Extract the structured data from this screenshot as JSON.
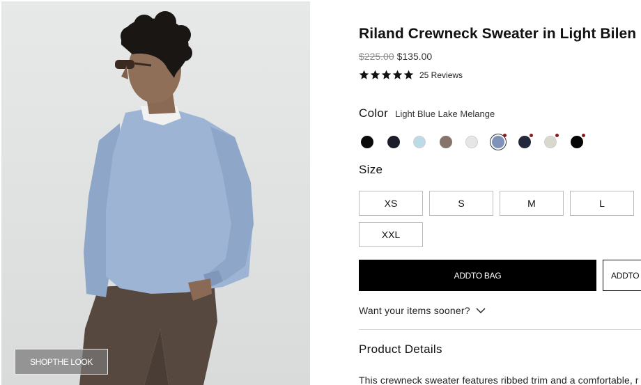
{
  "product": {
    "title": "Riland Crewneck Sweater in Light Bilen",
    "original_price": "$225.00",
    "sale_price": "$135.00",
    "rating": 5,
    "reviews_label": "25 Reviews"
  },
  "image": {
    "shop_the_look_label": "SHOPTHE LOOK"
  },
  "color": {
    "label": "Color",
    "selected_name": "Light Blue Lake Melange",
    "swatches": [
      {
        "color": "#0a0a0a",
        "selected": false,
        "flag": false
      },
      {
        "color": "#1b1e28",
        "selected": false,
        "flag": false
      },
      {
        "color": "#bcdbe6",
        "selected": false,
        "flag": false
      },
      {
        "color": "#857469",
        "selected": false,
        "flag": false
      },
      {
        "color": "#e6e6e6",
        "selected": false,
        "flag": false
      },
      {
        "color": "#7f92b8",
        "selected": true,
        "flag": true
      },
      {
        "color": "#23283a",
        "selected": false,
        "flag": true
      },
      {
        "color": "#d8d8cc",
        "selected": false,
        "flag": true
      },
      {
        "color": "#050505",
        "selected": false,
        "flag": true
      }
    ],
    "flag_color": "#8b1a1a"
  },
  "size": {
    "label": "Size",
    "options": [
      "XS",
      "S",
      "M",
      "L",
      "XXL"
    ]
  },
  "actions": {
    "add_to_bag": "ADDTO BAG",
    "add_to_secondary": "ADDTO"
  },
  "delivery": {
    "sooner_label": "Want your items sooner?"
  },
  "details": {
    "title": "Product Details",
    "text": "This crewneck sweater features ribbed trim and a comfortable, r"
  },
  "colors": {
    "primary_button": "#000000",
    "text": "#111111",
    "sale_strike": "#8a8a8a",
    "border": "#bdbdbd"
  }
}
